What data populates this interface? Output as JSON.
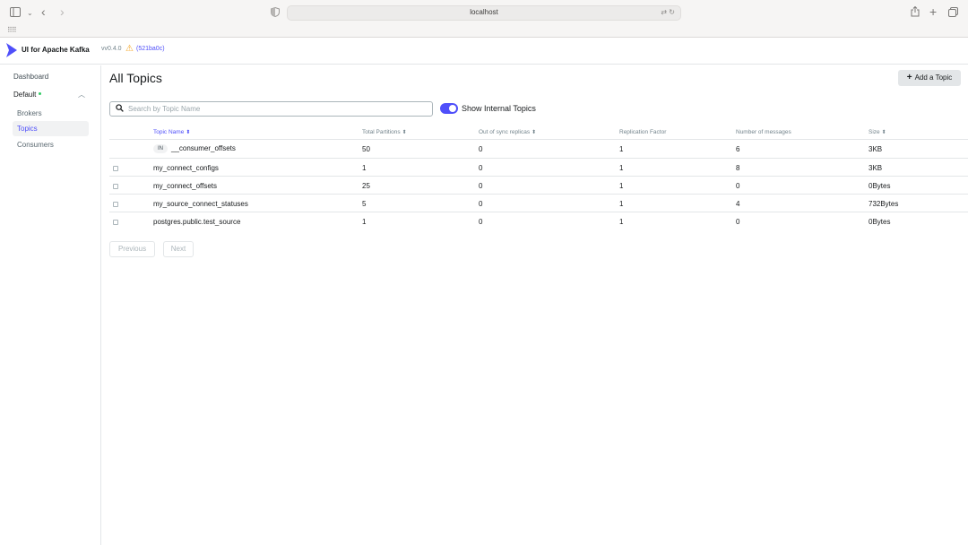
{
  "browser": {
    "url": "localhost",
    "bookmarks_icon": "grid-icon"
  },
  "app": {
    "brand": "UI for Apache Kafka",
    "version": "vv0.4.0",
    "commit": "(521ba0c)",
    "accent_color": "#4f4ffa"
  },
  "sidebar": {
    "dashboard": "Dashboard",
    "cluster": "Default",
    "items": [
      {
        "label": "Brokers",
        "active": false
      },
      {
        "label": "Topics",
        "active": true
      },
      {
        "label": "Consumers",
        "active": false
      }
    ]
  },
  "main": {
    "title": "All Topics",
    "add_button": "Add a Topic",
    "search_placeholder": "Search by Topic Name",
    "toggle_label": "Show Internal Topics",
    "toggle_on": true,
    "columns": [
      "Topic Name",
      "Total Partitions",
      "Out of sync replicas",
      "Replication Factor",
      "Number of messages",
      "Size"
    ],
    "rows": [
      {
        "internal": true,
        "badge": "IN",
        "name": "__consumer_offsets",
        "partitions": "50",
        "out_of_sync": "0",
        "replication": "1",
        "messages": "6",
        "size": "3KB"
      },
      {
        "internal": false,
        "name": "my_connect_configs",
        "partitions": "1",
        "out_of_sync": "0",
        "replication": "1",
        "messages": "8",
        "size": "3KB"
      },
      {
        "internal": false,
        "name": "my_connect_offsets",
        "partitions": "25",
        "out_of_sync": "0",
        "replication": "1",
        "messages": "0",
        "size": "0Bytes"
      },
      {
        "internal": false,
        "name": "my_source_connect_statuses",
        "partitions": "5",
        "out_of_sync": "0",
        "replication": "1",
        "messages": "4",
        "size": "732Bytes"
      },
      {
        "internal": false,
        "name": "postgres.public.test_source",
        "partitions": "1",
        "out_of_sync": "0",
        "replication": "1",
        "messages": "0",
        "size": "0Bytes"
      }
    ],
    "prev_label": "Previous",
    "next_label": "Next"
  }
}
